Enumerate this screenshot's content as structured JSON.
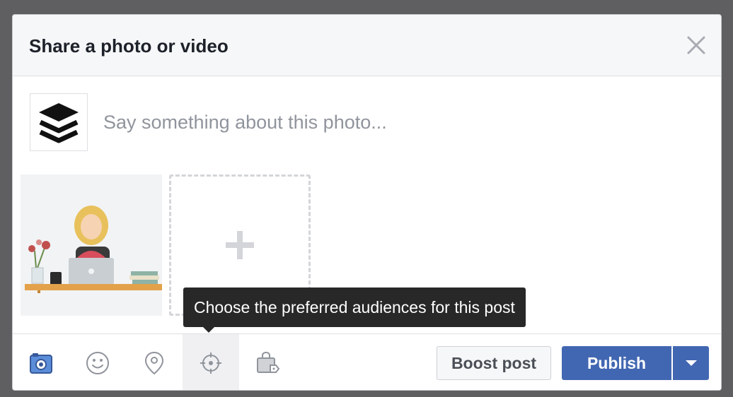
{
  "dialog": {
    "title": "Share a photo or video"
  },
  "composer": {
    "placeholder": "Say something about this photo...",
    "value": ""
  },
  "tooltip": {
    "text": "Choose the preferred audiences for this post"
  },
  "toolbar": {
    "tools": [
      {
        "icon": "camera-icon",
        "active": false,
        "selected": true
      },
      {
        "icon": "smiley-icon",
        "active": false
      },
      {
        "icon": "location-pin-icon",
        "active": false
      },
      {
        "icon": "target-icon",
        "active": true
      },
      {
        "icon": "shopping-bag-icon",
        "active": false
      }
    ],
    "boost_label": "Boost post",
    "publish_label": "Publish"
  },
  "colors": {
    "primary": "#4267b2",
    "header_bg": "#f6f7f9",
    "tooltip_bg": "#282828",
    "icon_gray": "#90949c"
  }
}
